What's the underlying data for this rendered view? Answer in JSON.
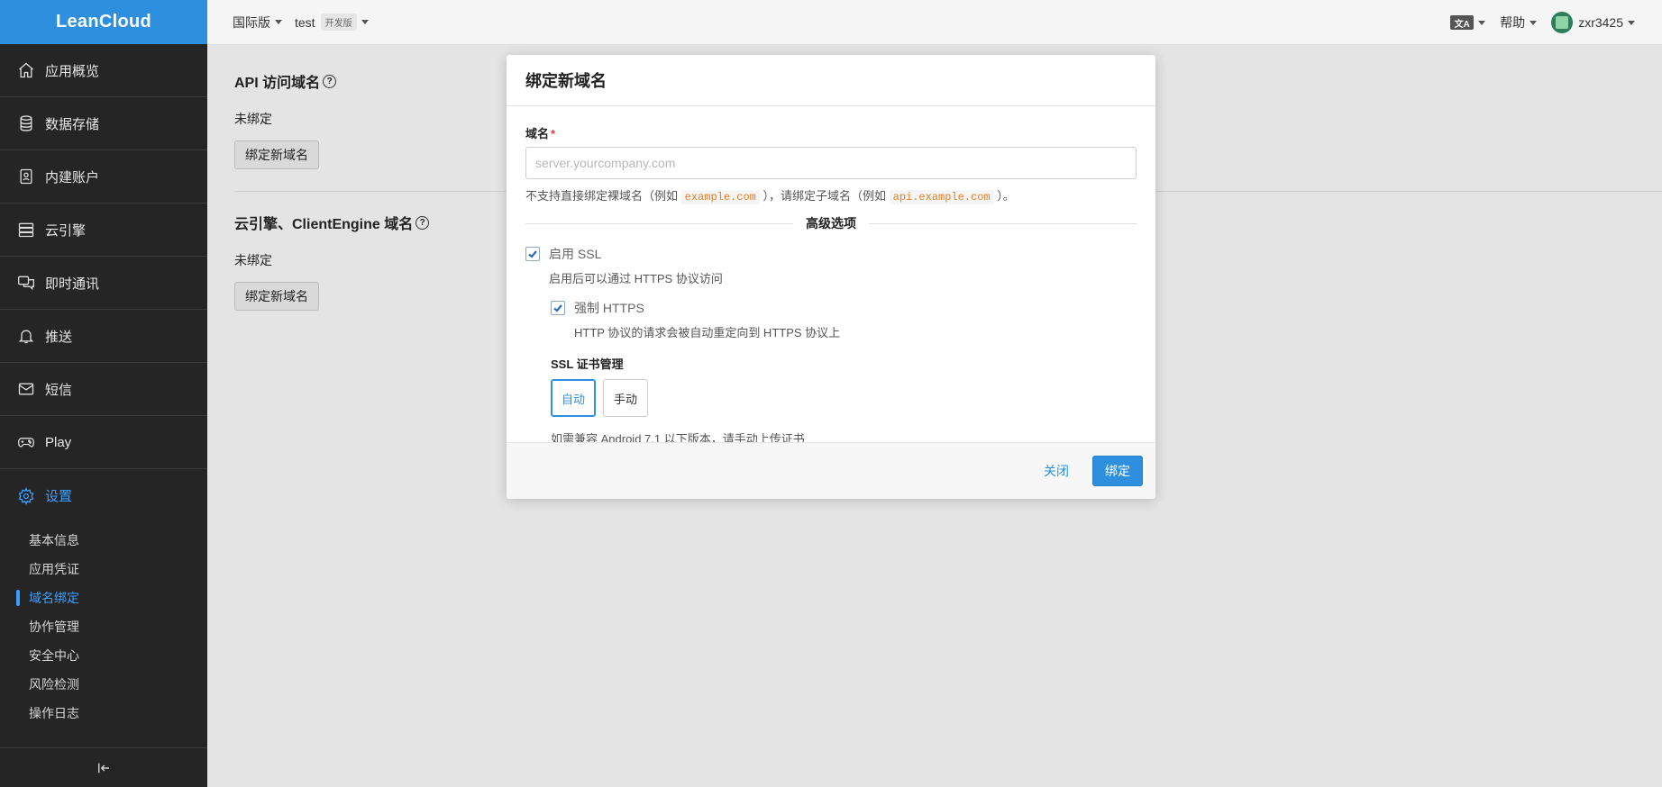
{
  "brand": "LeanCloud",
  "sidebar": {
    "items": [
      {
        "label": "应用概览",
        "icon": "home-icon"
      },
      {
        "label": "数据存储",
        "icon": "database-icon"
      },
      {
        "label": "内建账户",
        "icon": "id-badge-icon"
      },
      {
        "label": "云引擎",
        "icon": "server-icon"
      },
      {
        "label": "即时通讯",
        "icon": "chat-icon"
      },
      {
        "label": "推送",
        "icon": "bell-icon"
      },
      {
        "label": "短信",
        "icon": "mail-icon"
      },
      {
        "label": "Play",
        "icon": "gamepad-icon"
      },
      {
        "label": "设置",
        "icon": "gear-icon"
      }
    ],
    "sub_items": [
      "基本信息",
      "应用凭证",
      "域名绑定",
      "协作管理",
      "安全中心",
      "风险检测",
      "操作日志"
    ],
    "active_sub": "域名绑定"
  },
  "topbar": {
    "region": "国际版",
    "app": "test",
    "env_badge": "开发版",
    "lang_icon": "文A",
    "help": "帮助",
    "user": "zxr3425"
  },
  "main": {
    "api_section": {
      "title": "API 访问域名",
      "status": "未绑定",
      "button": "绑定新域名"
    },
    "engine_section": {
      "title": "云引擎、ClientEngine 域名",
      "status": "未绑定",
      "button": "绑定新域名"
    }
  },
  "modal": {
    "title": "绑定新域名",
    "domain_label": "域名",
    "required_mark": "*",
    "domain_placeholder": "server.yourcompany.com",
    "domain_value": "",
    "hint_part1": "不支持直接绑定裸域名（例如",
    "hint_code1": "example.com",
    "hint_part2": "），请绑定子域名（例如",
    "hint_code2": "api.example.com",
    "hint_part3": "）。",
    "advanced_label": "高级选项",
    "enable_ssl_label": "启用 SSL",
    "enable_ssl_checked": true,
    "enable_ssl_desc": "启用后可以通过 HTTPS 协议访问",
    "force_https_label": "强制 HTTPS",
    "force_https_checked": true,
    "force_https_desc": "HTTP 协议的请求会被自动重定向到 HTTPS 协议上",
    "ssl_cert_title": "SSL 证书管理",
    "ssl_cert_options": [
      "自动",
      "手动"
    ],
    "ssl_cert_selected": "自动",
    "ssl_cert_hint": "如需兼容 Android 7.1 以下版本，请手动上传证书",
    "close_label": "关闭",
    "bind_label": "绑定"
  },
  "colors": {
    "accent": "#2d8fde",
    "sidebar_bg": "#252526",
    "code_text": "#e67e22"
  }
}
